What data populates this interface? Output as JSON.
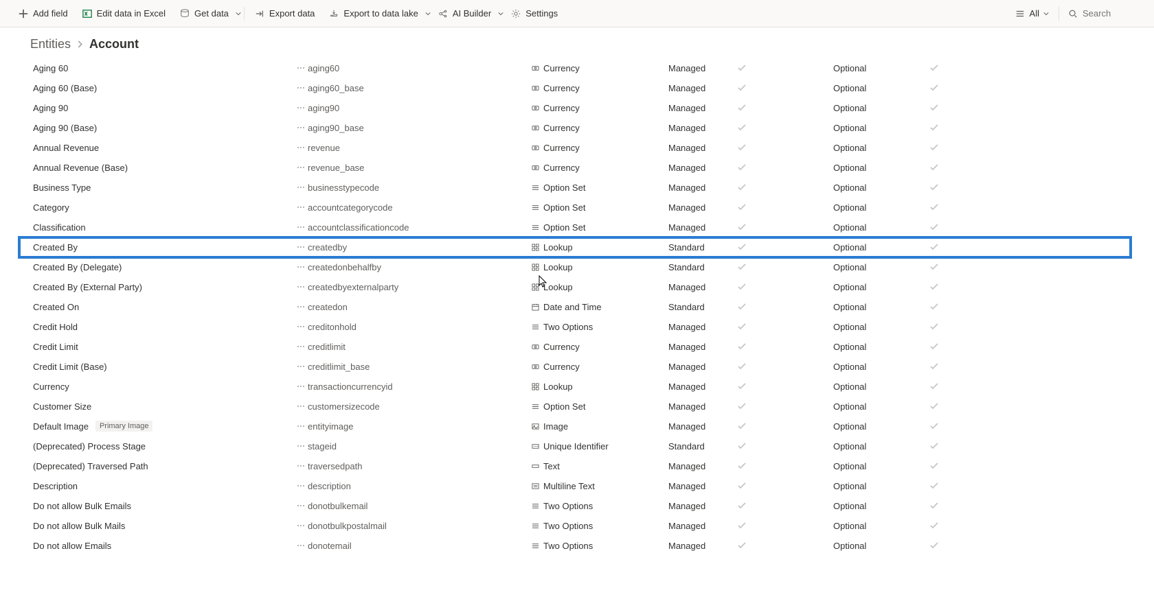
{
  "toolbar": {
    "add_field": "Add field",
    "edit_excel": "Edit data in Excel",
    "get_data": "Get data",
    "export_data": "Export data",
    "export_lake": "Export to data lake",
    "ai_builder": "AI Builder",
    "settings": "Settings",
    "filter_all": "All",
    "search_placeholder": "Search"
  },
  "breadcrumb": {
    "root": "Entities",
    "current": "Account"
  },
  "rows": [
    {
      "display": "Aging 60",
      "name": "aging60",
      "type": "Currency",
      "type_icon": "currency",
      "managed": "Managed",
      "req": "Optional",
      "highlight": false,
      "badge": ""
    },
    {
      "display": "Aging 60 (Base)",
      "name": "aging60_base",
      "type": "Currency",
      "type_icon": "currency",
      "managed": "Managed",
      "req": "Optional",
      "highlight": false,
      "badge": ""
    },
    {
      "display": "Aging 90",
      "name": "aging90",
      "type": "Currency",
      "type_icon": "currency",
      "managed": "Managed",
      "req": "Optional",
      "highlight": false,
      "badge": ""
    },
    {
      "display": "Aging 90 (Base)",
      "name": "aging90_base",
      "type": "Currency",
      "type_icon": "currency",
      "managed": "Managed",
      "req": "Optional",
      "highlight": false,
      "badge": ""
    },
    {
      "display": "Annual Revenue",
      "name": "revenue",
      "type": "Currency",
      "type_icon": "currency",
      "managed": "Managed",
      "req": "Optional",
      "highlight": false,
      "badge": ""
    },
    {
      "display": "Annual Revenue (Base)",
      "name": "revenue_base",
      "type": "Currency",
      "type_icon": "currency",
      "managed": "Managed",
      "req": "Optional",
      "highlight": false,
      "badge": ""
    },
    {
      "display": "Business Type",
      "name": "businesstypecode",
      "type": "Option Set",
      "type_icon": "optionset",
      "managed": "Managed",
      "req": "Optional",
      "highlight": false,
      "badge": ""
    },
    {
      "display": "Category",
      "name": "accountcategorycode",
      "type": "Option Set",
      "type_icon": "optionset",
      "managed": "Managed",
      "req": "Optional",
      "highlight": false,
      "badge": ""
    },
    {
      "display": "Classification",
      "name": "accountclassificationcode",
      "type": "Option Set",
      "type_icon": "optionset",
      "managed": "Managed",
      "req": "Optional",
      "highlight": false,
      "badge": ""
    },
    {
      "display": "Created By",
      "name": "createdby",
      "type": "Lookup",
      "type_icon": "lookup",
      "managed": "Standard",
      "req": "Optional",
      "highlight": true,
      "badge": ""
    },
    {
      "display": "Created By (Delegate)",
      "name": "createdonbehalfby",
      "type": "Lookup",
      "type_icon": "lookup",
      "managed": "Standard",
      "req": "Optional",
      "highlight": false,
      "badge": ""
    },
    {
      "display": "Created By (External Party)",
      "name": "createdbyexternalparty",
      "type": "Lookup",
      "type_icon": "lookup",
      "managed": "Managed",
      "req": "Optional",
      "highlight": false,
      "badge": ""
    },
    {
      "display": "Created On",
      "name": "createdon",
      "type": "Date and Time",
      "type_icon": "datetime",
      "managed": "Standard",
      "req": "Optional",
      "highlight": false,
      "badge": ""
    },
    {
      "display": "Credit Hold",
      "name": "creditonhold",
      "type": "Two Options",
      "type_icon": "twooptions",
      "managed": "Managed",
      "req": "Optional",
      "highlight": false,
      "badge": ""
    },
    {
      "display": "Credit Limit",
      "name": "creditlimit",
      "type": "Currency",
      "type_icon": "currency",
      "managed": "Managed",
      "req": "Optional",
      "highlight": false,
      "badge": ""
    },
    {
      "display": "Credit Limit (Base)",
      "name": "creditlimit_base",
      "type": "Currency",
      "type_icon": "currency",
      "managed": "Managed",
      "req": "Optional",
      "highlight": false,
      "badge": ""
    },
    {
      "display": "Currency",
      "name": "transactioncurrencyid",
      "type": "Lookup",
      "type_icon": "lookup",
      "managed": "Managed",
      "req": "Optional",
      "highlight": false,
      "badge": ""
    },
    {
      "display": "Customer Size",
      "name": "customersizecode",
      "type": "Option Set",
      "type_icon": "optionset",
      "managed": "Managed",
      "req": "Optional",
      "highlight": false,
      "badge": ""
    },
    {
      "display": "Default Image",
      "name": "entityimage",
      "type": "Image",
      "type_icon": "image",
      "managed": "Managed",
      "req": "Optional",
      "highlight": false,
      "badge": "Primary Image"
    },
    {
      "display": "(Deprecated) Process Stage",
      "name": "stageid",
      "type": "Unique Identifier",
      "type_icon": "uid",
      "managed": "Standard",
      "req": "Optional",
      "highlight": false,
      "badge": ""
    },
    {
      "display": "(Deprecated) Traversed Path",
      "name": "traversedpath",
      "type": "Text",
      "type_icon": "text",
      "managed": "Managed",
      "req": "Optional",
      "highlight": false,
      "badge": ""
    },
    {
      "display": "Description",
      "name": "description",
      "type": "Multiline Text",
      "type_icon": "multitext",
      "managed": "Managed",
      "req": "Optional",
      "highlight": false,
      "badge": ""
    },
    {
      "display": "Do not allow Bulk Emails",
      "name": "donotbulkemail",
      "type": "Two Options",
      "type_icon": "twooptions",
      "managed": "Managed",
      "req": "Optional",
      "highlight": false,
      "badge": ""
    },
    {
      "display": "Do not allow Bulk Mails",
      "name": "donotbulkpostalmail",
      "type": "Two Options",
      "type_icon": "twooptions",
      "managed": "Managed",
      "req": "Optional",
      "highlight": false,
      "badge": ""
    },
    {
      "display": "Do not allow Emails",
      "name": "donotemail",
      "type": "Two Options",
      "type_icon": "twooptions",
      "managed": "Managed",
      "req": "Optional",
      "highlight": false,
      "badge": ""
    }
  ]
}
